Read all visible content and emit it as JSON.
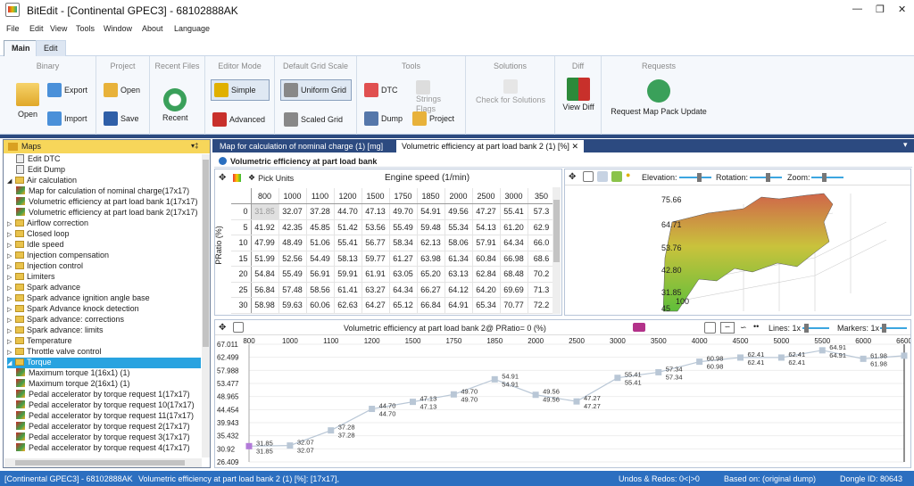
{
  "window": {
    "title": "BitEdit - [Continental GPEC3] - 68102888AK"
  },
  "menu": [
    "File",
    "Edit",
    "View",
    "Tools",
    "Window",
    "About",
    "Language"
  ],
  "ribbon_tabs": [
    "Main",
    "Edit"
  ],
  "ribbon": {
    "binary": {
      "label": "Binary",
      "open": "Open",
      "export": "Export",
      "import": "Import"
    },
    "project": {
      "label": "Project",
      "open": "Open",
      "save": "Save"
    },
    "recent": {
      "label": "Recent Files",
      "recent": "Recent"
    },
    "editor_mode": {
      "label": "Editor Mode",
      "simple": "Simple",
      "advanced": "Advanced"
    },
    "grid_scale": {
      "label": "Default Grid Scale",
      "uniform": "Uniform Grid",
      "scaled": "Scaled Grid"
    },
    "tools": {
      "label": "Tools",
      "dtc": "DTC",
      "strings": "Strings",
      "flags": "Flags",
      "dump": "Dump",
      "project": "Project"
    },
    "solutions": {
      "label": "Solutions",
      "check": "Check for Solutions"
    },
    "diff": {
      "label": "Diff",
      "view": "View Diff"
    },
    "requests": {
      "label": "Requests",
      "update": "Request Map Pack Update"
    }
  },
  "maps_panel": {
    "title": "Maps",
    "items": [
      {
        "label": "Edit DTC",
        "type": "doc",
        "indent": 1
      },
      {
        "label": "Edit Dump",
        "type": "doc",
        "indent": 1
      },
      {
        "label": "Air calculation",
        "type": "folder",
        "indent": 0,
        "open": true
      },
      {
        "label": "Map for calculation of nominal charge(17x17)",
        "type": "map",
        "indent": 1
      },
      {
        "label": "Volumetric efficiency at part load bank 1(17x17)",
        "type": "map",
        "indent": 1
      },
      {
        "label": "Volumetric efficiency at part load bank 2(17x17)",
        "type": "map",
        "indent": 1
      },
      {
        "label": "Airflow correction",
        "type": "folder",
        "indent": 0
      },
      {
        "label": "Closed loop",
        "type": "folder",
        "indent": 0
      },
      {
        "label": "Idle speed",
        "type": "folder",
        "indent": 0
      },
      {
        "label": "Injection compensation",
        "type": "folder",
        "indent": 0
      },
      {
        "label": "Injection control",
        "type": "folder",
        "indent": 0
      },
      {
        "label": "Limiters",
        "type": "folder",
        "indent": 0
      },
      {
        "label": "Spark advance",
        "type": "folder",
        "indent": 0
      },
      {
        "label": "Spark advance ignition angle base",
        "type": "folder",
        "indent": 0
      },
      {
        "label": "Spark Advance knock detection",
        "type": "folder",
        "indent": 0
      },
      {
        "label": "Spark advance: corrections",
        "type": "folder",
        "indent": 0
      },
      {
        "label": "Spark advance: limits",
        "type": "folder",
        "indent": 0
      },
      {
        "label": "Temperature",
        "type": "folder",
        "indent": 0
      },
      {
        "label": "Throttle valve control",
        "type": "folder",
        "indent": 0
      },
      {
        "label": "Torque",
        "type": "folder",
        "indent": 0,
        "open": true,
        "selected": true
      },
      {
        "label": "Maximum torque 1(16x1) (1)",
        "type": "map",
        "indent": 1
      },
      {
        "label": "Maximum torque 2(16x1) (1)",
        "type": "map",
        "indent": 1
      },
      {
        "label": "Pedal accelerator by torque request 1(17x17)",
        "type": "map",
        "indent": 1
      },
      {
        "label": "Pedal accelerator by torque request 10(17x17)",
        "type": "map",
        "indent": 1
      },
      {
        "label": "Pedal accelerator by torque request 11(17x17)",
        "type": "map",
        "indent": 1
      },
      {
        "label": "Pedal accelerator by torque request 2(17x17)",
        "type": "map",
        "indent": 1
      },
      {
        "label": "Pedal accelerator by torque request 3(17x17)",
        "type": "map",
        "indent": 1
      },
      {
        "label": "Pedal accelerator by torque request 4(17x17)",
        "type": "map",
        "indent": 1
      }
    ]
  },
  "doc_tabs": [
    "Map for calculation of nominal charge (1) [mg]",
    "Volumetric efficiency at part load bank 2 (1) [%]"
  ],
  "panel_title": "Volumetric efficiency at part load bank",
  "grid": {
    "pick_units": "Pick Units",
    "x_axis_label": "Engine speed (1/min)",
    "y_axis_label": "PRatio (%)",
    "columns": [
      "800",
      "1000",
      "1100",
      "1200",
      "1500",
      "1750",
      "1850",
      "2000",
      "2500",
      "3000",
      "350"
    ],
    "rows": [
      {
        "h": "0",
        "v": [
          "31.85",
          "32.07",
          "37.28",
          "44.70",
          "47.13",
          "49.70",
          "54.91",
          "49.56",
          "47.27",
          "55.41",
          "57.3"
        ]
      },
      {
        "h": "5",
        "v": [
          "41.92",
          "42.35",
          "45.85",
          "51.42",
          "53.56",
          "55.49",
          "59.48",
          "55.34",
          "54.13",
          "61.20",
          "62.9"
        ]
      },
      {
        "h": "10",
        "v": [
          "47.99",
          "48.49",
          "51.06",
          "55.41",
          "56.77",
          "58.34",
          "62.13",
          "58.06",
          "57.91",
          "64.34",
          "66.0"
        ]
      },
      {
        "h": "15",
        "v": [
          "51.99",
          "52.56",
          "54.49",
          "58.13",
          "59.77",
          "61.27",
          "63.98",
          "61.34",
          "60.84",
          "66.98",
          "68.6"
        ]
      },
      {
        "h": "20",
        "v": [
          "54.84",
          "55.49",
          "56.91",
          "59.91",
          "61.91",
          "63.05",
          "65.20",
          "63.13",
          "62.84",
          "68.48",
          "70.2"
        ]
      },
      {
        "h": "25",
        "v": [
          "56.84",
          "57.48",
          "58.56",
          "61.41",
          "63.27",
          "64.34",
          "66.27",
          "64.12",
          "64.20",
          "69.69",
          "71.3"
        ]
      },
      {
        "h": "30",
        "v": [
          "58.98",
          "59.63",
          "60.06",
          "62.63",
          "64.27",
          "65.12",
          "66.84",
          "64.91",
          "65.34",
          "70.77",
          "72.2"
        ]
      }
    ]
  },
  "view3d": {
    "elevation": "Elevation:",
    "rotation": "Rotation:",
    "zoom": "Zoom:",
    "z_ticks": [
      "75.66",
      "64.71",
      "53.76",
      "42.80",
      "31.85",
      "45",
      "100"
    ]
  },
  "graph": {
    "title": "Volumetric efficiency at part load bank 2@ PRatio= 0 (%)",
    "lines_label": "Lines: 1x",
    "markers_label": "Markers: 1x",
    "x_ticks": [
      "800",
      "1000",
      "1100",
      "1200",
      "1500",
      "1750",
      "1850",
      "2000",
      "2500",
      "3000",
      "3500",
      "4000",
      "4500",
      "5000",
      "5500",
      "6000",
      "6600"
    ],
    "y_ticks": [
      "67.011",
      "62.499",
      "57.988",
      "53.477",
      "48.965",
      "44.454",
      "39.943",
      "35.432",
      "30.92",
      "26.409"
    ]
  },
  "chart_data": {
    "type": "line",
    "title": "Volumetric efficiency at part load bank 2@ PRatio= 0 (%)",
    "categories": [
      "800",
      "1000",
      "1100",
      "1200",
      "1500",
      "1750",
      "1850",
      "2000",
      "2500",
      "3000",
      "3500",
      "4000",
      "4500",
      "5000",
      "5500",
      "6000",
      "6600"
    ],
    "series": [
      {
        "values": [
          31.85,
          32.07,
          37.28,
          44.7,
          47.13,
          49.7,
          54.91,
          49.56,
          47.27,
          55.41,
          57.34,
          60.98,
          62.41,
          62.41,
          64.91,
          61.98,
          63.05
        ]
      }
    ],
    "ylim": [
      26.409,
      67.011
    ]
  },
  "status": {
    "left": "[Continental GPEC3] - 68102888AK",
    "map": "Volumetric efficiency at part load bank 2 (1) [%]: [17x17],",
    "undos": "Undos & Redos: 0<|>0",
    "based": "Based on: (original dump)",
    "dongle": "Dongle ID: 80643"
  },
  "colors": {
    "accent": "#2c6fc0",
    "selection": "#29a3e0",
    "tree_header": "#f7d65a",
    "series": "#b9c7d6"
  }
}
